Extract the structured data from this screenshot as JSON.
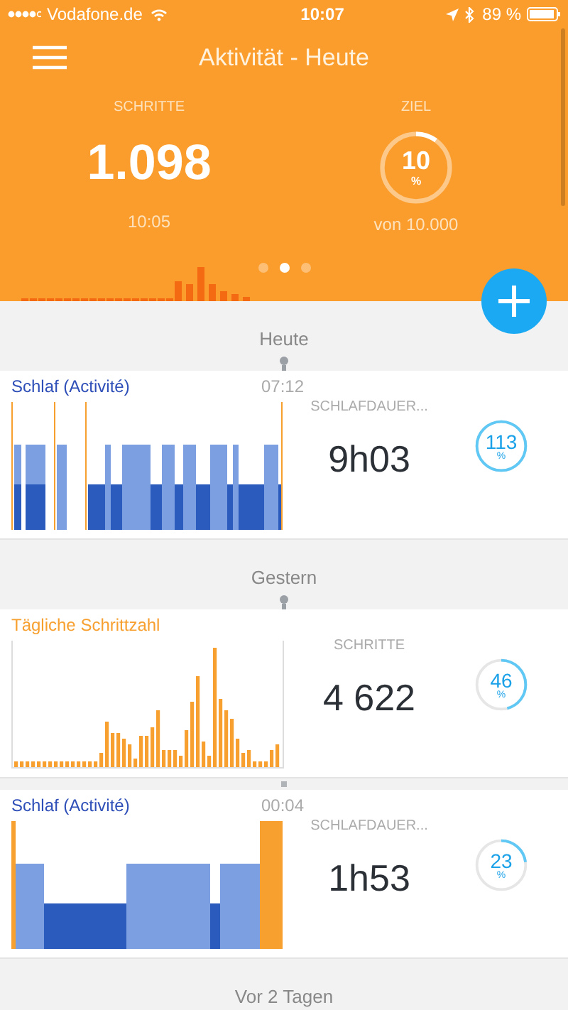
{
  "status_bar": {
    "carrier": "Vodafone.de",
    "time": "10:07",
    "battery": "89 %"
  },
  "header": {
    "title": "Aktivität - Heute",
    "steps_label": "SCHRITTE",
    "steps": "1.098",
    "time": "10:05",
    "goal_label": "ZIEL",
    "goal_percent": "10",
    "goal_unit": "%",
    "goal_of": "von 10.000",
    "page_dots": [
      {
        "selected": false
      },
      {
        "selected": true
      },
      {
        "selected": false
      }
    ]
  },
  "sections": [
    {
      "heading": "Heute",
      "cards": [
        {
          "kind": "sleep",
          "title": "Schlaf (Activité)",
          "time": "07:12",
          "stat_label": "SCHLAFDAUER...",
          "value": "9h03",
          "percent": "113",
          "unit": "%"
        }
      ]
    },
    {
      "heading": "Gestern",
      "cards": [
        {
          "kind": "steps",
          "title": "Tägliche Schrittzahl",
          "stat_label": "SCHRITTE",
          "value": "4 622",
          "percent": "46",
          "unit": "%"
        },
        {
          "kind": "sleep",
          "title": "Schlaf (Activité)",
          "time": "00:04",
          "stat_label": "SCHLAFDAUER...",
          "value": "1h53",
          "percent": "23",
          "unit": "%"
        }
      ]
    },
    {
      "heading": "Vor 2 Tagen"
    }
  ]
}
